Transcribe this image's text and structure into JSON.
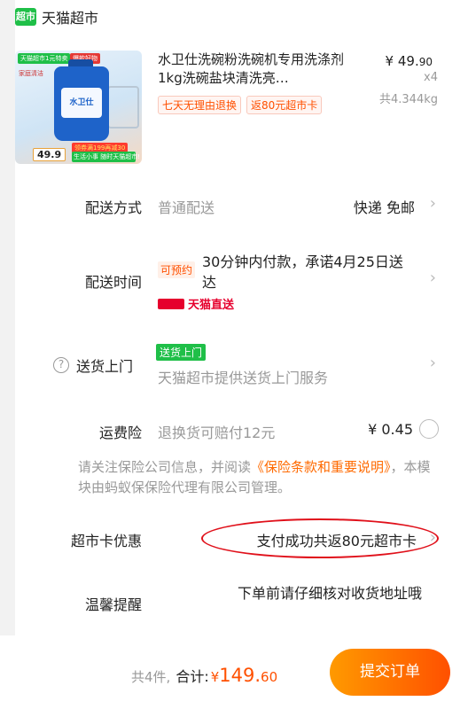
{
  "store": {
    "logo_text": "超市",
    "name": "天猫超市"
  },
  "product": {
    "thumb": {
      "tag_top": "天猫超市1元特卖",
      "tag_red": "爆款好物",
      "side_note": "家庭清洁",
      "brand_label": "水卫仕",
      "promo_band": "领券满199再减30",
      "price_badge": "49.9",
      "green_band": "生活小事 随时天猫超市!"
    },
    "title": "水卫仕洗碗粉洗碗机专用洗涤剂1kg洗碗盐块清洗亮…",
    "tags": [
      "七天无理由退换",
      "返80元超市卡"
    ],
    "price_symbol": "¥",
    "price_int": "49.",
    "price_dec": "90",
    "qty": "x4",
    "weight": "共4.344kg"
  },
  "shipping": {
    "label": "配送方式",
    "value": "普通配送",
    "right": "快递 免邮"
  },
  "delivery_time": {
    "label": "配送时间",
    "tag": "可预约",
    "text": "30分钟内付款，承诺4月25日送达",
    "carrier": "天猫直送"
  },
  "door": {
    "label": "送货上门",
    "tag": "送货上门",
    "desc": "天猫超市提供送货上门服务"
  },
  "insurance": {
    "label": "运费险",
    "value": "退换货可赔付12元",
    "price": "¥ 0.45",
    "notice_pre": "请关注保险公司信息，并阅读",
    "notice_link": "《保险条款和重要说明》",
    "notice_post": "，本模块由蚂蚁保保险代理有限公司管理。"
  },
  "card_offer": {
    "label": "超市卡优惠",
    "value": "支付成功共返80元超市卡"
  },
  "reminder": {
    "label": "温馨提醒",
    "text": "下单前请仔细核对收货地址哦"
  },
  "bottom": {
    "count": "共4件,",
    "total_label": "合计:",
    "currency": "¥",
    "total_int": "149.",
    "total_dec": "60",
    "submit": "提交订单"
  },
  "colors": {
    "accent": "#ff5000",
    "brand_green": "#1fbf48",
    "mark_red": "#e0101a"
  }
}
